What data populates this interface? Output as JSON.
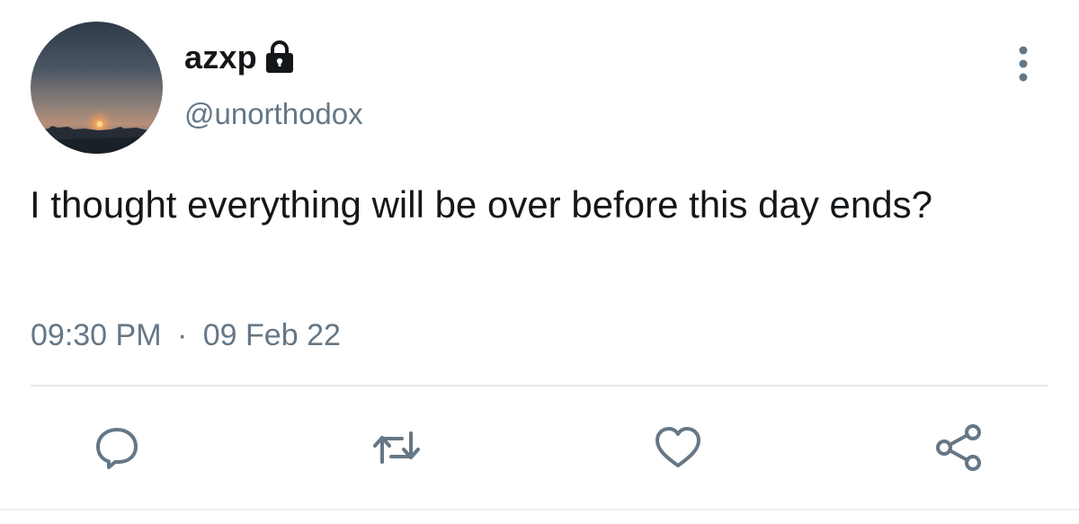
{
  "user": {
    "display_name": "azxp",
    "handle": "@unorthodox",
    "avatar_icon": "avatar-photo-sunset",
    "protected_icon": "lock-icon"
  },
  "tweet": {
    "text": "I thought everything will be over before this day ends?",
    "time": "09:30 PM",
    "separator": "·",
    "date": "09 Feb 22"
  },
  "actions": {
    "reply_icon": "reply-icon",
    "retweet_icon": "retweet-icon",
    "like_icon": "heart-icon",
    "share_icon": "share-icon",
    "more_icon": "more-vertical-icon"
  },
  "colors": {
    "text": "#14171a",
    "secondary": "#657786",
    "divider": "#e6ecf0"
  }
}
